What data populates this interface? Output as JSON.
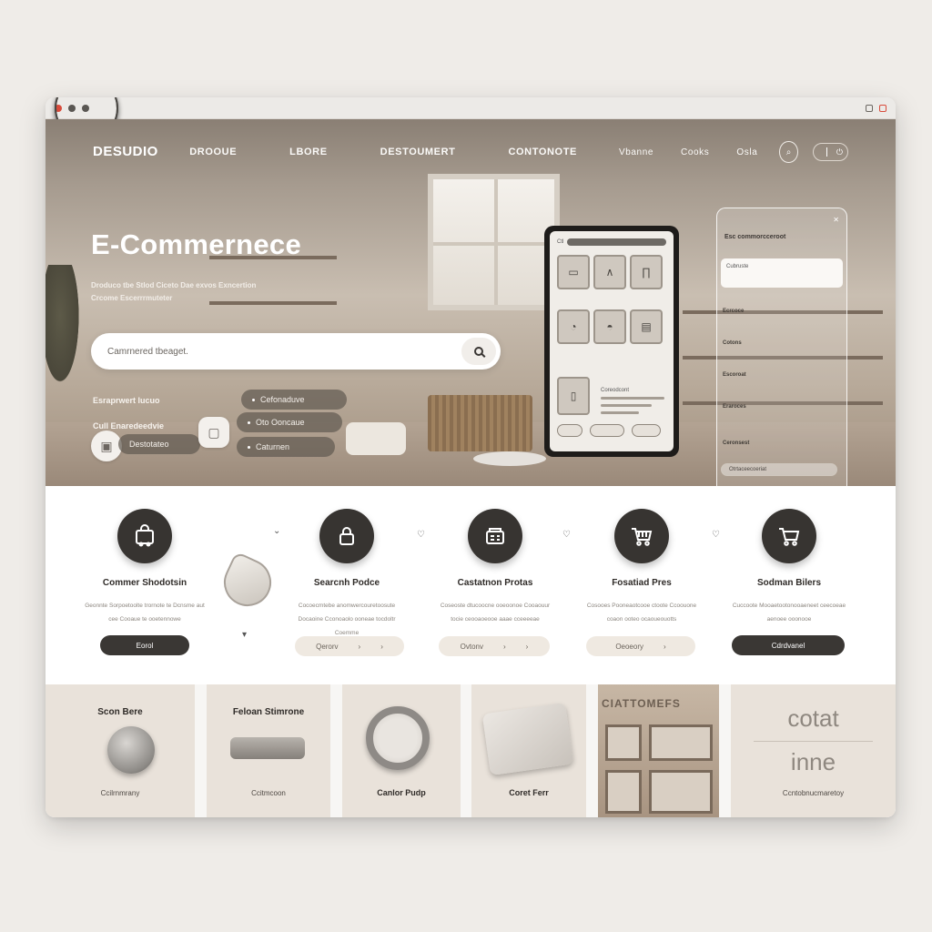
{
  "window": {
    "chrome_icons": [
      "close-dot",
      "minimize-dot",
      "maximize-dot",
      "back-icon",
      "forward-icon"
    ]
  },
  "nav": {
    "logo": "DESUDIO",
    "logo_sub": "",
    "links": [
      "DROOUE",
      "LBORE",
      "DESTOUMERT",
      "CONTONOTE",
      "Vbanne",
      "Cooks",
      "Osla"
    ]
  },
  "hero": {
    "title": "E-Commernece",
    "subtitle": "Droduco tbe Stlod Ciceto Dae exvos Exncertion Crcome Escerrrmuteter",
    "search_placeholder": "Camrnered tbeaget.",
    "line1": "Esraprwert lucuo",
    "line2": "Cull Enaredeedvie",
    "pill1": "Destotateo",
    "pill2": "Oto Ooncaue",
    "pill3": "Caturnen",
    "pill4": "Cefonaduve"
  },
  "phone": {
    "bar_label": "Ctl",
    "card_label": "Coreodcont"
  },
  "glass": {
    "title": "Esc commorcceroot",
    "field": "Cubruste",
    "items": [
      "Ecrcoce",
      "Cotons",
      "Escoroat",
      "Eraroces",
      "Ceronsest"
    ],
    "input": "Otrtaceecoeriat"
  },
  "features": [
    {
      "title": "Commer Shodotsin",
      "desc": "Geonnte Sorpoetoolte trornote te Dcnsme aut cee Cooaue te ooetennowe",
      "button": "Eorol",
      "style": "dark",
      "icon": "bag-icon"
    },
    {
      "title": "Searcnh Podce",
      "desc": "Cocoecmtebe anomwercouretoosute Docaoine Cconoaolo ooneae tocdoltr Coemme",
      "button": "Qerorv",
      "style": "light",
      "icon": "lock-icon"
    },
    {
      "title": "Castatnon Protas",
      "desc": "Coseoste dtucoocne ooeoonoe Cooaouur tocie ceooaoeooe aaae cceeeeae",
      "button": "Ovtonv",
      "style": "light",
      "icon": "register-icon"
    },
    {
      "title": "Fosatiad Pres",
      "desc": "Cosooes Pooneaotcooe ctoote Ccoouone coaon ooteo ocaoueouotts",
      "button": "Oeoeory",
      "style": "light",
      "icon": "cart-icon"
    },
    {
      "title": "Sodman Bilers",
      "desc": "Cuccoote Mooaetootonooaeneet ceecoeae aenoee ooonooe",
      "button": "Cdrdvanel",
      "style": "dark",
      "icon": "cart-icon"
    }
  ],
  "cards": [
    {
      "title": "Scon Bere",
      "caption": "Ccilrnmrany"
    },
    {
      "title": "Feloan Stimrone",
      "caption": "Ccitmcoon"
    },
    {
      "title": "",
      "caption": "Canlor Pudp"
    },
    {
      "title": "",
      "caption": "Coret Ferr"
    },
    {
      "title": "CIATTOMEFS",
      "caption": ""
    },
    {
      "title": "cotat",
      "title2": "inne",
      "caption": "Ccntobnucmaretoy"
    }
  ]
}
